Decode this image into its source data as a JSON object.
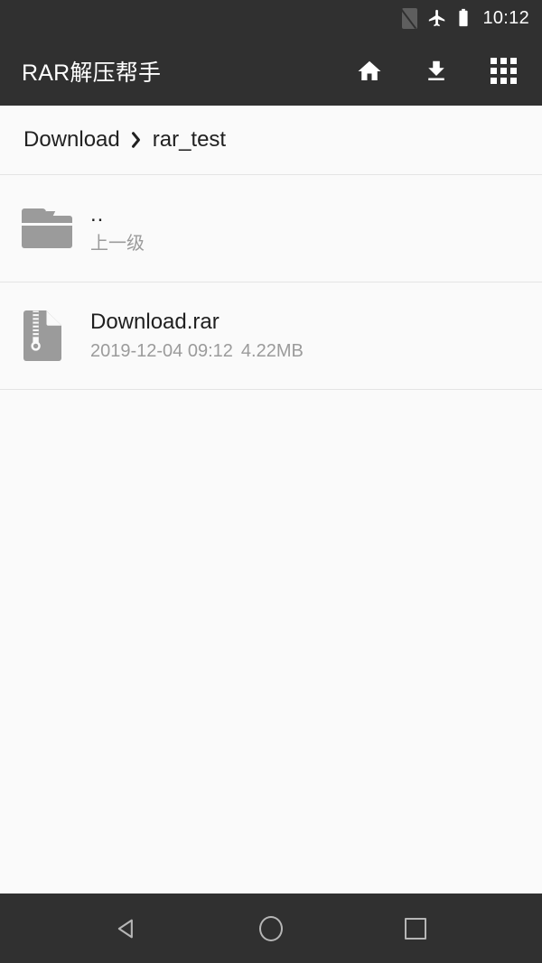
{
  "status_bar": {
    "time": "10:12",
    "icons": [
      "no-sim-icon",
      "airplane-mode-icon",
      "battery-icon"
    ]
  },
  "app_bar": {
    "title": "RAR解压帮手",
    "actions": [
      {
        "name": "home-button",
        "icon": "home-icon"
      },
      {
        "name": "download-button",
        "icon": "download-icon"
      },
      {
        "name": "apps-grid-button",
        "icon": "apps-grid-icon"
      }
    ]
  },
  "breadcrumb": {
    "separator": "›",
    "items": [
      {
        "label": "Download"
      },
      {
        "label": "rar_test"
      }
    ]
  },
  "file_list": {
    "rows": [
      {
        "icon": "folder-icon",
        "title": "..",
        "subtitle": "上一级",
        "type": "folder"
      },
      {
        "icon": "rar-archive-icon",
        "title": "Download.rar",
        "date": "2019-12-04 09:12",
        "size": "4.22MB",
        "type": "file"
      }
    ]
  },
  "nav_bar": {
    "buttons": [
      {
        "name": "nav-back-button",
        "icon": "triangle-back-icon"
      },
      {
        "name": "nav-home-button",
        "icon": "circle-home-icon"
      },
      {
        "name": "nav-recents-button",
        "icon": "square-recents-icon"
      }
    ]
  },
  "colors": {
    "chrome": "#303030",
    "background": "#fafafa",
    "divider": "#e4e4e4",
    "icon_gray": "#9b9b9b",
    "text_primary": "#1f1f1f",
    "text_secondary": "#9b9b9b",
    "nav_icon": "#b6b6b6"
  }
}
